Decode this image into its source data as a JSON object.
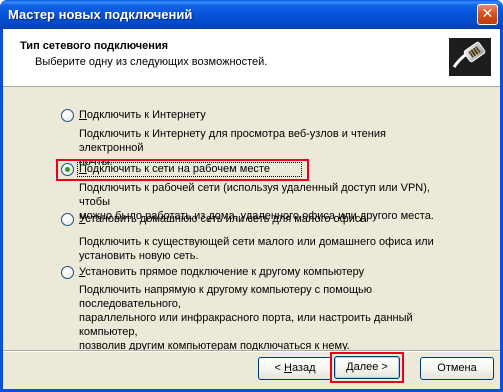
{
  "window": {
    "title": "Мастер новых подключений",
    "close_glyph": "✕"
  },
  "header": {
    "title": "Тип сетевого подключения",
    "subtitle": "Выберите одну из следующих возможностей.",
    "icon": "network-connection-icon"
  },
  "options": [
    {
      "label_prefix": "",
      "label_accel": "П",
      "label_rest": "одключить к Интернету",
      "desc_line1": "Подключить к Интернету для просмотра веб-узлов и чтения  электронной",
      "desc_line2": "почты.",
      "selected": false
    },
    {
      "label_prefix": "",
      "label_accel": "П",
      "label_rest": "одключить к сети на рабочем месте",
      "desc_line1": "Подключить к рабочей сети (используя удаленный доступ или VPN), чтобы",
      "desc_line2": "можно было работать из дома, удаленного офиса или другого места.",
      "selected": true
    },
    {
      "label_prefix": "",
      "label_accel": "У",
      "label_rest": "становить домашнюю сеть или сеть для малого офиса",
      "desc_line1": "Подключить к существующей сети малого или домашнего офиса или",
      "desc_line2": "установить новую сеть.",
      "selected": false
    },
    {
      "label_prefix": "",
      "label_accel": "У",
      "label_rest": "становить прямое подключение к другому компьютеру",
      "desc_line1": "Подключить напрямую к другому компьютеру с помощью последовательного,",
      "desc_line2": "параллельного или инфракрасного порта, или настроить данный компьютер,",
      "desc_line3": "позволив другим  компьютерам подключаться к нему.",
      "selected": false
    }
  ],
  "buttons": {
    "back_arrow": "<",
    "back_accel": "Н",
    "back_rest": "азад",
    "next_accel": "Д",
    "next_rest": "алее",
    "next_arrow": ">",
    "cancel": "Отмена"
  },
  "colors": {
    "highlight_box": "#e8001c",
    "radio_dot": "#21a121",
    "titlebar": "#0452d6",
    "dialog_bg": "#ece9d8"
  }
}
